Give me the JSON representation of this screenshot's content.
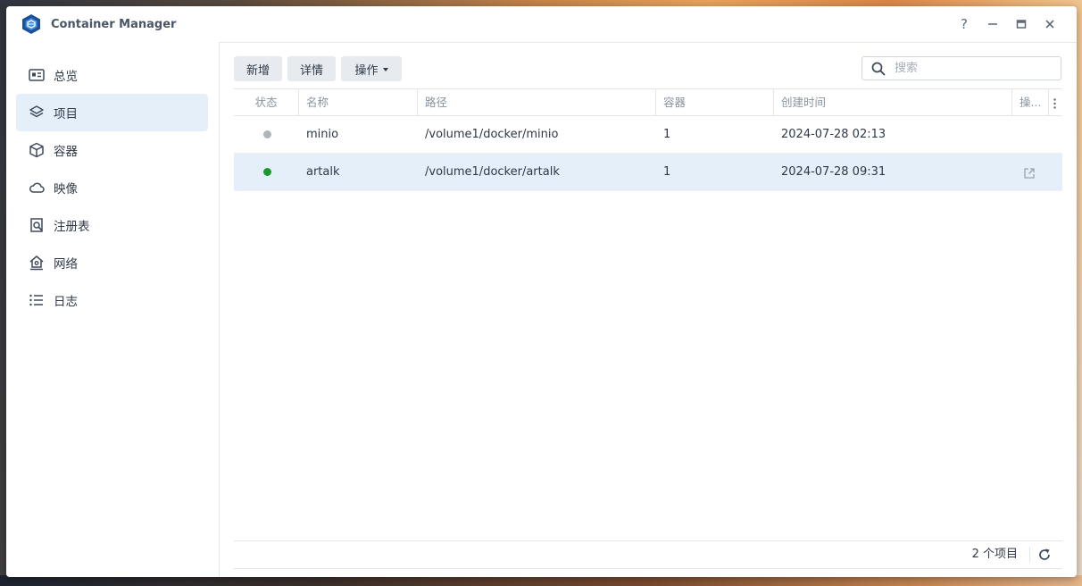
{
  "app": {
    "title": "Container Manager",
    "icon": "container-manager-logo"
  },
  "window_controls": {
    "help": "?",
    "icons": [
      "help-icon",
      "minimize-icon",
      "maximize-icon",
      "close-icon"
    ]
  },
  "sidebar": {
    "active_index": 1,
    "items": [
      {
        "label": "总览",
        "icon": "overview-icon"
      },
      {
        "label": "项目",
        "icon": "project-layers-icon"
      },
      {
        "label": "容器",
        "icon": "container-box-icon"
      },
      {
        "label": "映像",
        "icon": "cloud-icon"
      },
      {
        "label": "注册表",
        "icon": "registry-search-icon"
      },
      {
        "label": "网络",
        "icon": "network-home-icon"
      },
      {
        "label": "日志",
        "icon": "log-list-icon"
      }
    ]
  },
  "toolbar": {
    "add_label": "新增",
    "details_label": "详情",
    "action_label": "操作"
  },
  "search": {
    "placeholder": "搜索",
    "value": ""
  },
  "table": {
    "columns": [
      "状态",
      "名称",
      "路径",
      "容器",
      "创建时间",
      "操..."
    ],
    "rows": [
      {
        "status": "stopped",
        "status_color": "#b0b5bc",
        "name": "minio",
        "path": "/volume1/docker/minio",
        "containers": "1",
        "created": "2024-07-28 02:13",
        "selected": false
      },
      {
        "status": "running",
        "status_color": "#1a9a2a",
        "name": "artalk",
        "path": "/volume1/docker/artalk",
        "containers": "1",
        "created": "2024-07-28 09:31",
        "selected": true
      }
    ]
  },
  "footer": {
    "count_text": "2 个项目"
  },
  "colors": {
    "accent": "#1f6fd1",
    "selected_bg": "#e4effa",
    "running": "#1a9a2a",
    "stopped": "#b0b5bc"
  }
}
